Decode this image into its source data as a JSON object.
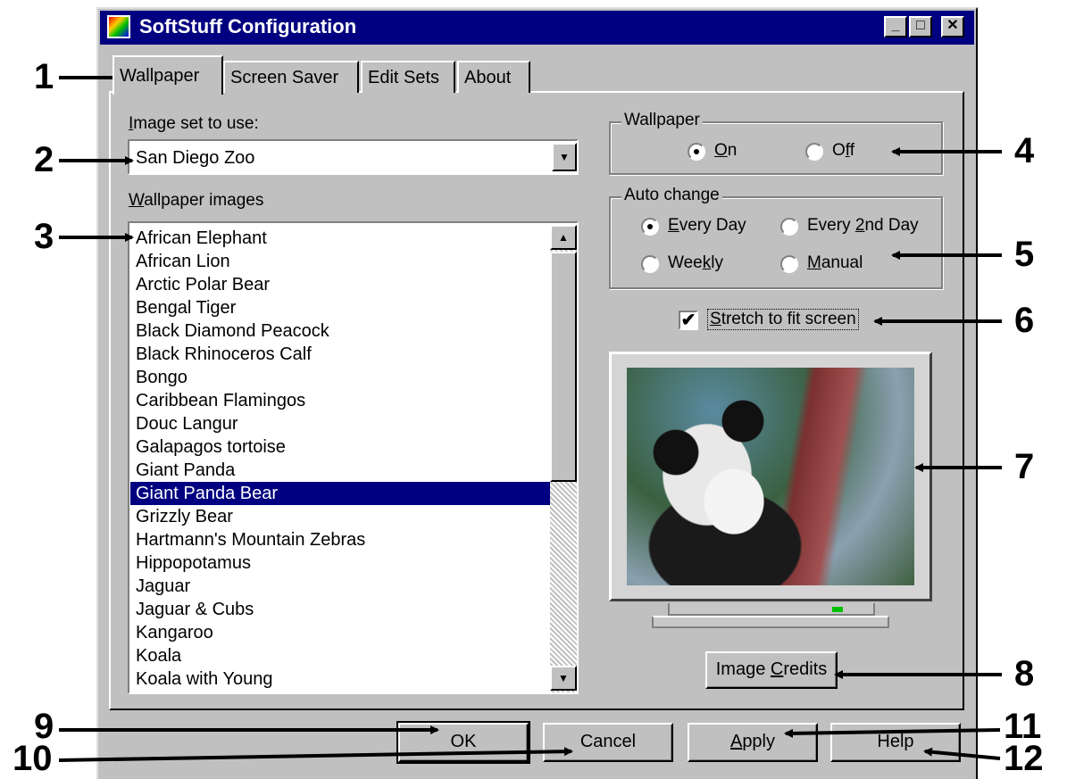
{
  "window": {
    "title": "SoftStuff Configuration",
    "controls": {
      "minimize": "_",
      "maximize": "□",
      "close": "✕"
    }
  },
  "tabs": [
    {
      "label": "Wallpaper",
      "active": true
    },
    {
      "label": "Screen Saver",
      "active": false
    },
    {
      "label": "Edit Sets",
      "active": false
    },
    {
      "label": "About",
      "active": false
    }
  ],
  "image_set": {
    "label_access": "I",
    "label_rest": "mage set to use:",
    "value": "San Diego Zoo"
  },
  "wallpaper_images": {
    "label_access": "W",
    "label_rest": "allpaper images",
    "items": [
      "African Elephant",
      "African Lion",
      "Arctic Polar Bear",
      "Bengal Tiger",
      "Black Diamond Peacock",
      "Black Rhinoceros Calf",
      "Bongo",
      "Caribbean Flamingos",
      "Douc Langur",
      "Galapagos tortoise",
      "Giant Panda",
      "Giant Panda Bear",
      "Grizzly Bear",
      "Hartmann's Mountain Zebras",
      "Hippopotamus",
      "Jaguar",
      "Jaguar & Cubs",
      "Kangaroo",
      "Koala",
      "Koala with Young"
    ],
    "selected": "Giant Panda Bear"
  },
  "wallpaper_group": {
    "title": "Wallpaper",
    "on": {
      "access": "O",
      "rest": "n",
      "checked": true
    },
    "off": {
      "pre": "O",
      "access": "f",
      "post": "f",
      "checked": false
    }
  },
  "auto_change": {
    "title": "Auto change",
    "every_day": {
      "access": "E",
      "rest": "very Day",
      "checked": true
    },
    "every_2nd_day": {
      "pre": "Every ",
      "access": "2",
      "post": "nd Day",
      "checked": false
    },
    "weekly": {
      "pre": "Wee",
      "access": "k",
      "post": "ly",
      "checked": false
    },
    "manual": {
      "access": "M",
      "rest": "anual",
      "checked": false
    }
  },
  "stretch": {
    "access": "S",
    "rest": "tretch to fit screen",
    "checked": true,
    "mark": "✔"
  },
  "preview": {
    "subject": "giant panda"
  },
  "buttons": {
    "image_credits": {
      "pre": "Image ",
      "access": "C",
      "post": "redits"
    },
    "ok": "OK",
    "cancel": "Cancel",
    "apply": {
      "access": "A",
      "rest": "pply"
    },
    "help": "Help"
  },
  "scroll": {
    "up": "▲",
    "down": "▼"
  },
  "combo_arrow": "▼",
  "callouts": [
    "1",
    "2",
    "3",
    "4",
    "5",
    "6",
    "7",
    "8",
    "9",
    "10",
    "11",
    "12"
  ],
  "colors": {
    "title_bar": "#000080",
    "face": "#c0c0c0",
    "selection": "#000080"
  }
}
